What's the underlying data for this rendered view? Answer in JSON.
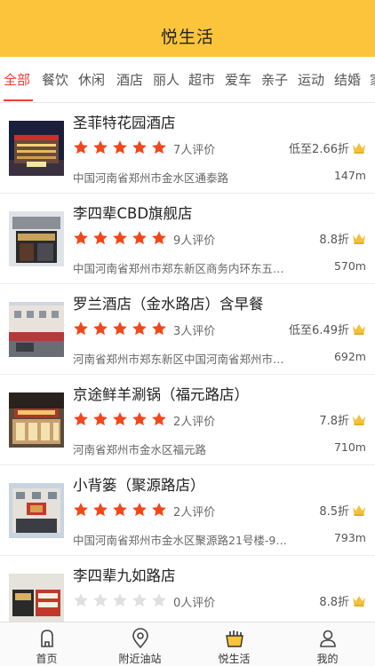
{
  "header": {
    "title": "悦生活"
  },
  "colors": {
    "accent": "#fcc43a",
    "active": "#f03c2e",
    "star_on": "#f2471b",
    "star_off": "#e0e0e0",
    "crown": "#f3c13b"
  },
  "tabs": [
    {
      "label": "全部",
      "active": true
    },
    {
      "label": "餐饮",
      "active": false
    },
    {
      "label": "休闲",
      "active": false
    },
    {
      "label": "酒店",
      "active": false
    },
    {
      "label": "丽人",
      "active": false
    },
    {
      "label": "超市",
      "active": false
    },
    {
      "label": "爱车",
      "active": false
    },
    {
      "label": "亲子",
      "active": false
    },
    {
      "label": "运动",
      "active": false
    },
    {
      "label": "结婚",
      "active": false
    },
    {
      "label": "家",
      "active": false
    }
  ],
  "shops": [
    {
      "name": "圣菲特花园酒店",
      "rating": 5,
      "reviews": "7人评价",
      "discount": "低至2.66折",
      "address": "中国河南省郑州市金水区通泰路",
      "distance": "147m",
      "image": "hotel-night-photo"
    },
    {
      "name": "李四辈CBD旗舰店",
      "rating": 5,
      "reviews": "9人评价",
      "discount": "8.8折",
      "address": "中国河南省郑州市郑东新区商务内环东五…",
      "distance": "570m",
      "image": "restaurant-storefront-photo"
    },
    {
      "name": "罗兰酒店（金水路店）含早餐",
      "rating": 5,
      "reviews": "3人评价",
      "discount": "低至6.49折",
      "address": "河南省郑州市郑东新区中国河南省郑州市…",
      "distance": "692m",
      "image": "hotel-street-photo"
    },
    {
      "name": "京途鲜羊涮锅（福元路店）",
      "rating": 5,
      "reviews": "2人评价",
      "discount": "7.8折",
      "address": "河南省郑州市金水区福元路",
      "distance": "710m",
      "image": "hotpot-storefront-photo"
    },
    {
      "name": "小背篓（聚源路店）",
      "rating": 5,
      "reviews": "2人评价",
      "discount": "8.5折",
      "address": "中国河南省郑州市金水区聚源路21号楼-9…",
      "distance": "793m",
      "image": "restaurant-building-photo"
    },
    {
      "name": "李四辈九如路店",
      "rating": 0,
      "reviews": "0人评价",
      "discount": "8.8折",
      "address": "",
      "distance": "",
      "image": "shop-sign-photo"
    }
  ],
  "bottom_nav": [
    {
      "label": "首页",
      "icon": "home-icon"
    },
    {
      "label": "附近油站",
      "icon": "location-pin-icon"
    },
    {
      "label": "悦生活",
      "icon": "shopping-bag-icon",
      "active": true
    },
    {
      "label": "我的",
      "icon": "user-icon"
    }
  ]
}
